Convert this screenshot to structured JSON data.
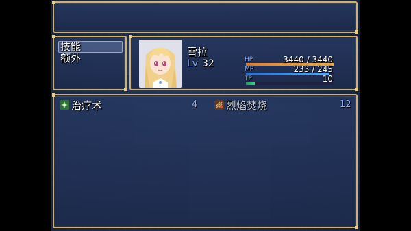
{
  "skill_categories": [
    {
      "label": "技能"
    },
    {
      "label": "额外"
    }
  ],
  "actor": {
    "name": "雪拉",
    "level_label": "Lv",
    "level": "32",
    "hp_label": "HP",
    "hp_value": "3440 / 3440",
    "hp_fraction": 1.0,
    "mp_label": "MP",
    "mp_value": "233 / 245",
    "mp_fraction": 0.951,
    "tp_label": "TP",
    "tp_value": "10",
    "tp_fraction": 0.1
  },
  "skills": [
    {
      "name": "治疗术",
      "cost": "4",
      "icon": "heal-icon",
      "icon_color": "#5bb85b"
    },
    {
      "name": "烈焰焚烧",
      "cost": "12",
      "icon": "flame-icon",
      "icon_color": "#b7773a"
    }
  ],
  "colors": {
    "window_border": "#c9b27a",
    "system_blue": "#84aaff",
    "hp_gauge": "#e08a2c",
    "mp_gauge": "#3f8fd9",
    "tp_gauge": "#2aa86a"
  }
}
